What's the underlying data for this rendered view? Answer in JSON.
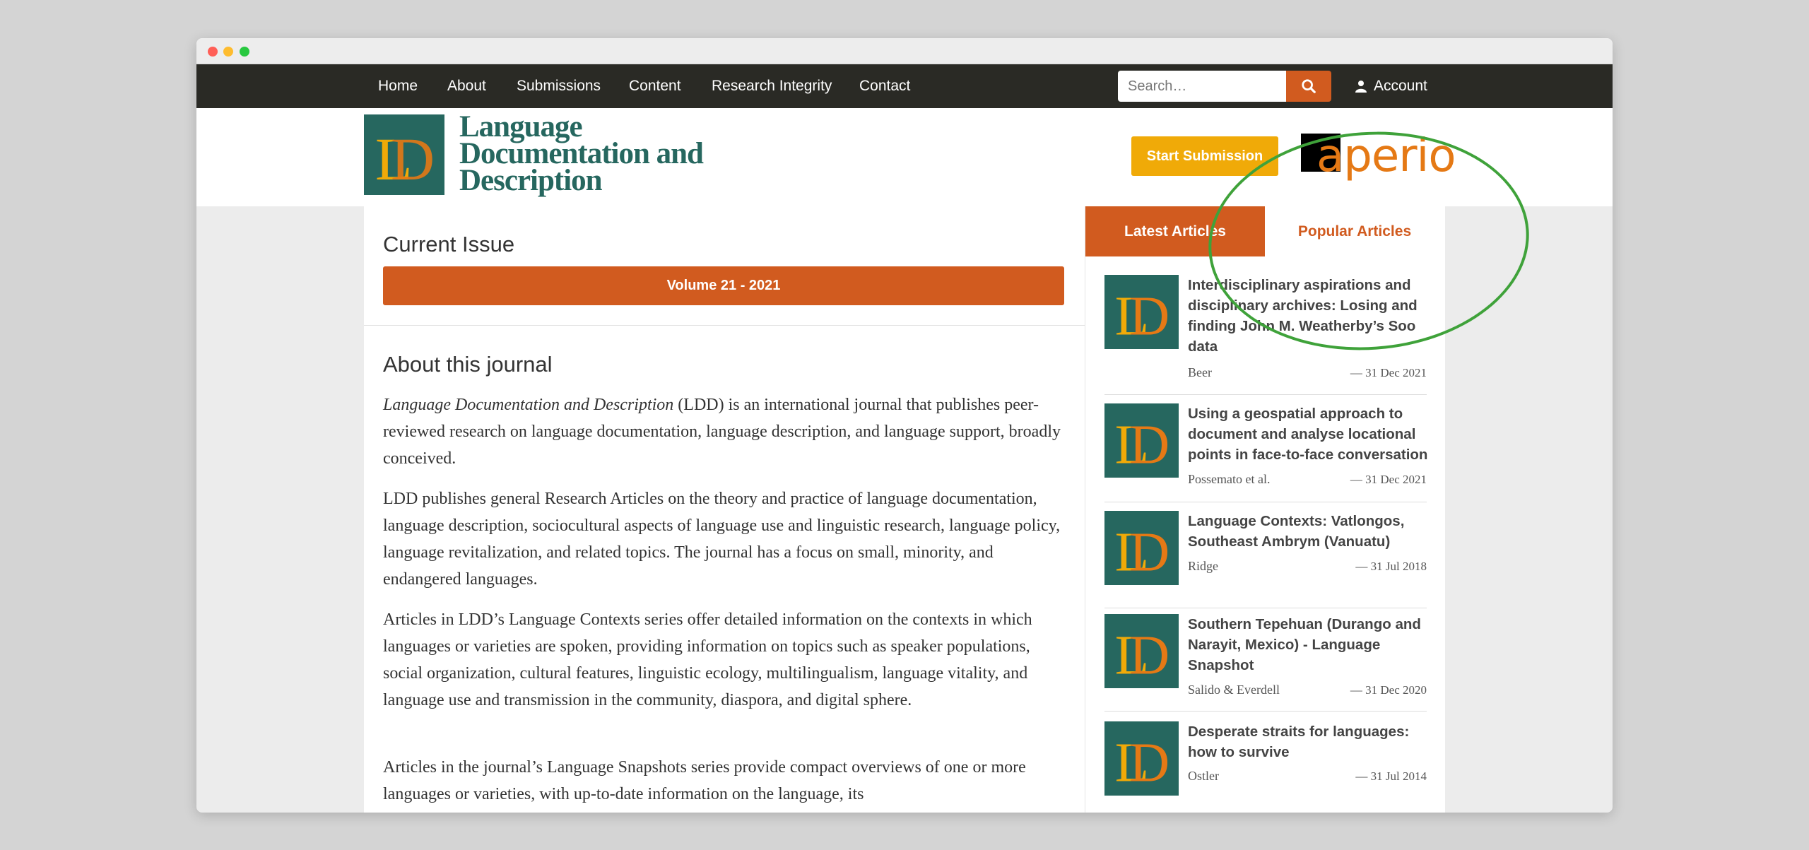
{
  "nav": {
    "items": [
      "Home",
      "About",
      "Submissions",
      "Content",
      "Research Integrity",
      "Contact"
    ],
    "search_placeholder": "Search…",
    "account_label": "Account"
  },
  "header": {
    "logo_line1": "Language",
    "logo_line2": "Documentation and",
    "logo_line3": "Description",
    "start_submission": "Start Submission",
    "partner_logo": "aperio"
  },
  "main": {
    "current_issue_title": "Current Issue",
    "volume_label": "Volume 21 - 2021",
    "about_title": "About this journal",
    "about_journal_name": "Language Documentation and Description",
    "about_p1_rest": " (LDD) is an international journal that publishes peer-reviewed research on language documentation, language description, and language support, broadly conceived.",
    "about_p2": "LDD publishes general Research Articles on the theory and practice of language documentation, language description, sociocultural aspects of language use and linguistic research, language policy, language revitalization, and related topics. The journal has a focus on small, minority, and endangered languages.",
    "about_p3": "Articles in LDD’s Language Contexts series offer detailed information on the contexts in which languages or varieties are spoken, providing information on topics such as speaker populations, social organization, cultural features, linguistic ecology, multilingualism, language vitality, and language use and transmission in the community, diaspora, and digital sphere.",
    "about_p4": "Articles in the journal’s Language Snapshots series provide compact overviews of one or more languages or varieties, with up-to-date information on the language, its"
  },
  "sidebar": {
    "tab_latest": "Latest Articles",
    "tab_popular": "Popular Articles",
    "articles": [
      {
        "title": "Interdisciplinary aspirations and disciplinary archives: Losing and finding John M. Weatherby’s Soo data",
        "author": "Beer",
        "date": "—  31 Dec 2021"
      },
      {
        "title": "Using a geospatial approach to document and analyse locational points in face-to-face conversation",
        "author": "Possemato et al.",
        "date": "—  31 Dec 2021"
      },
      {
        "title": "Language Contexts: Vatlongos, Southeast Ambrym (Vanuatu)",
        "author": "Ridge",
        "date": "—  31 Jul 2018"
      },
      {
        "title": "Southern Tepehuan (Durango and Narayit, Mexico) - Language Snapshot",
        "author": "Salido & Everdell",
        "date": "—  31 Dec 2020"
      },
      {
        "title": "Desperate straits for languages: how to survive",
        "author": "Ostler",
        "date": "—  31 Jul 2014"
      }
    ]
  },
  "colors": {
    "brand_teal": "#26675f",
    "accent_orange": "#d15b1f",
    "start_yellow": "#f0aa08",
    "nav_dark": "#2a2a25",
    "annotation_green": "#3fa23a"
  },
  "icons": [
    "search-icon",
    "user-icon",
    "ldd-logo-icon"
  ]
}
